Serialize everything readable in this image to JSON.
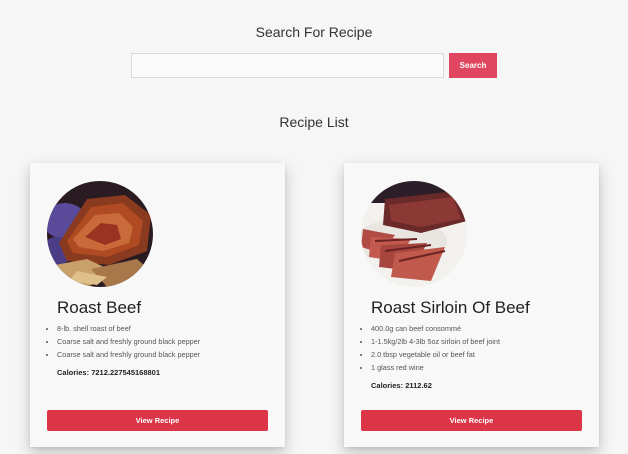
{
  "search": {
    "title": "Search For Recipe",
    "placeholder": "",
    "value": "",
    "button_label": "Search"
  },
  "list": {
    "title": "Recipe List"
  },
  "recipes": [
    {
      "name": "Roast Beef",
      "ingredients": [
        "8-lb. shell roast of beef",
        "Coarse salt and freshly ground black pepper",
        "Coarse salt and freshly ground black pepper"
      ],
      "calories_label": "Calories:",
      "calories": "7212.227545168801",
      "button_label": "View Recipe"
    },
    {
      "name": "Roast Sirloin Of Beef",
      "ingredients": [
        "400.0g can beef consommé",
        "1-1.5kg/2lb 4-3lb 5oz sirloin of beef joint",
        "2.0 tbsp vegetable oil or beef fat",
        "1 glass red wine"
      ],
      "calories_label": "Calories:",
      "calories": "2112.62",
      "button_label": "View Recipe"
    }
  ],
  "colors": {
    "search_button": "#e0465f",
    "view_button": "#dc3548",
    "background": "#f6f6f6"
  }
}
